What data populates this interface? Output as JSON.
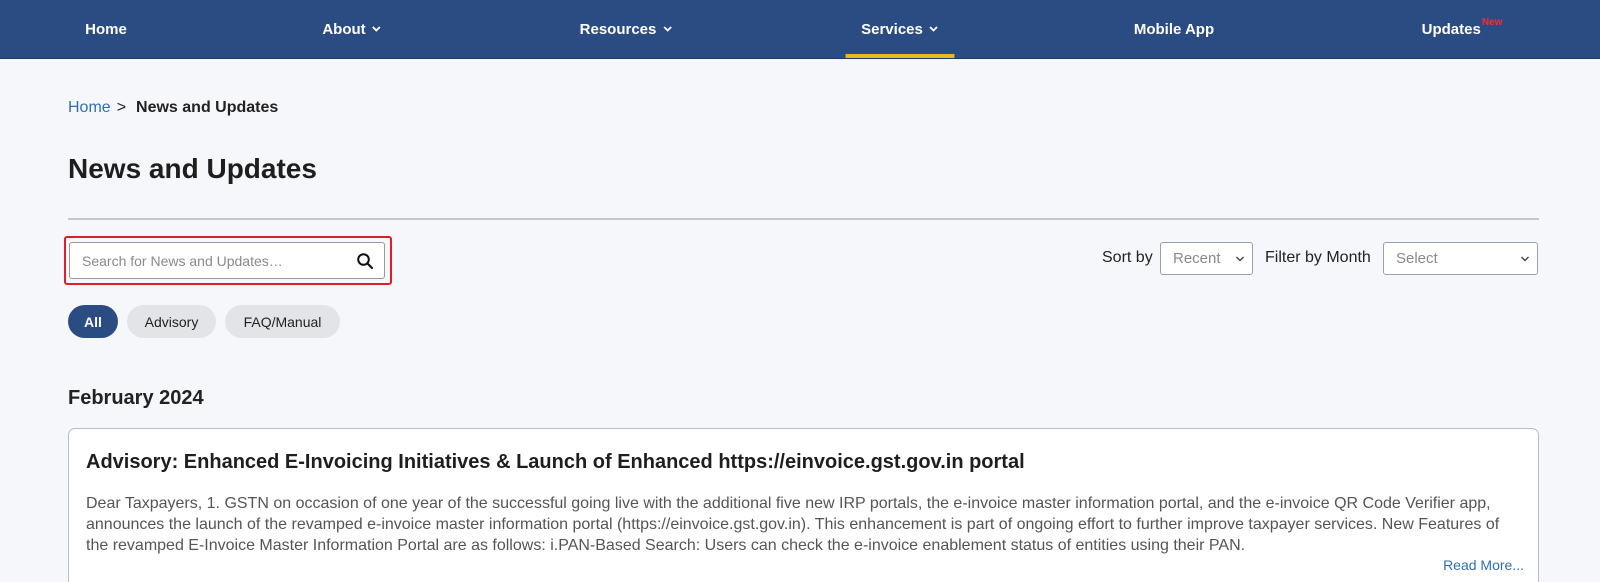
{
  "nav": {
    "items": [
      {
        "label": "Home"
      },
      {
        "label": "About"
      },
      {
        "label": "Resources"
      },
      {
        "label": "Services"
      },
      {
        "label": "Mobile App"
      },
      {
        "label": "Updates",
        "badge": "New"
      }
    ],
    "active": "Services",
    "active_color": "#e9b81f",
    "background": "#2b4c83"
  },
  "breadcrumb": {
    "home": "Home",
    "separator": ">",
    "current": "News and Updates"
  },
  "page_title": "News and Updates",
  "search": {
    "placeholder": "Search for News and Updates…",
    "value": ""
  },
  "sort": {
    "label": "Sort by",
    "selected": "Recent"
  },
  "filter": {
    "label": "Filter by Month",
    "selected": "Select"
  },
  "categories": [
    {
      "label": "All",
      "active": true
    },
    {
      "label": "Advisory",
      "active": false
    },
    {
      "label": "FAQ/Manual",
      "active": false
    }
  ],
  "month_group": "February 2024",
  "news": [
    {
      "title": "Advisory: Enhanced E-Invoicing Initiatives & Launch of Enhanced https://einvoice.gst.gov.in portal",
      "summary": "Dear Taxpayers, 1. GSTN on occasion of one year of the successful going live with the additional five new IRP portals, the e-invoice master information portal, and the e-invoice QR Code Verifier app, announces the launch of the revamped e-invoice master information portal (https://einvoice.gst.gov.in). This enhancement is part of ongoing effort to further improve taxpayer services. New Features of the revamped E-Invoice Master Information Portal are as follows: i.PAN-Based Search: Users can check the e-invoice enablement status of entities using their PAN.",
      "read_more": "Read More..."
    }
  ]
}
